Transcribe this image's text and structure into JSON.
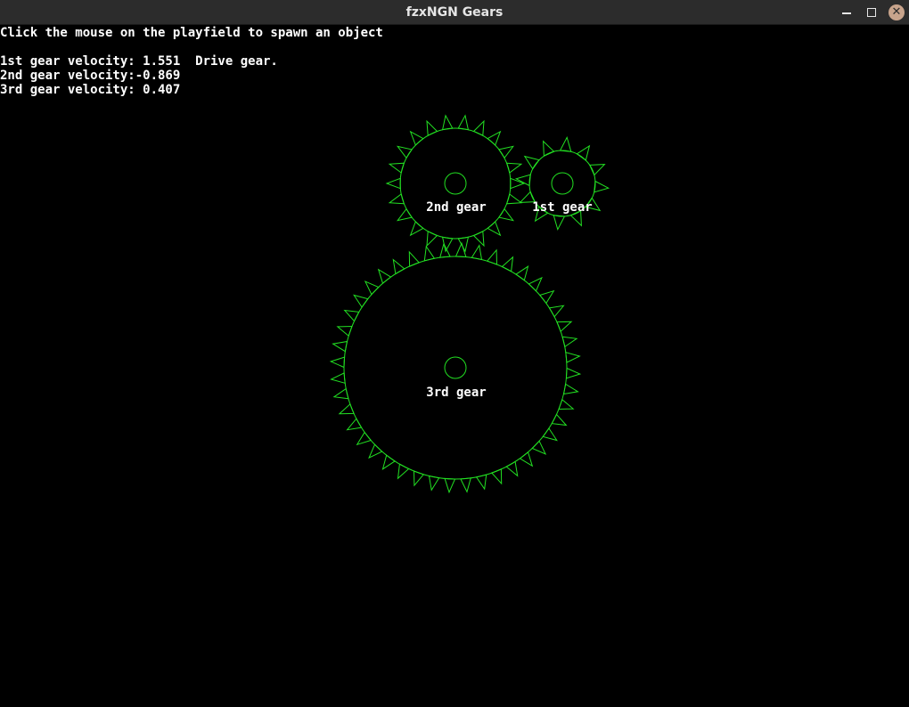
{
  "window": {
    "title": "fzxNGN Gears",
    "controls": {
      "close_glyph": "✕"
    }
  },
  "hud": {
    "instructions": "Click the mouse on the playfield to spawn an object",
    "velocity_lines": [
      "1st gear velocity: 1.551  Drive gear.",
      "2nd gear velocity:-0.869",
      "3rd gear velocity: 0.407"
    ]
  },
  "gears": [
    {
      "label": "1st gear",
      "teeth": 12,
      "drive": true
    },
    {
      "label": "2nd gear",
      "teeth": 22,
      "drive": false
    },
    {
      "label": "3rd gear",
      "teeth": 44,
      "drive": false
    }
  ],
  "colors": {
    "background": "#000000",
    "gear_stroke": "#22e022",
    "text": "#ffffff",
    "titlebar": "#2c2c2c",
    "close_button": "#c8a48c"
  }
}
